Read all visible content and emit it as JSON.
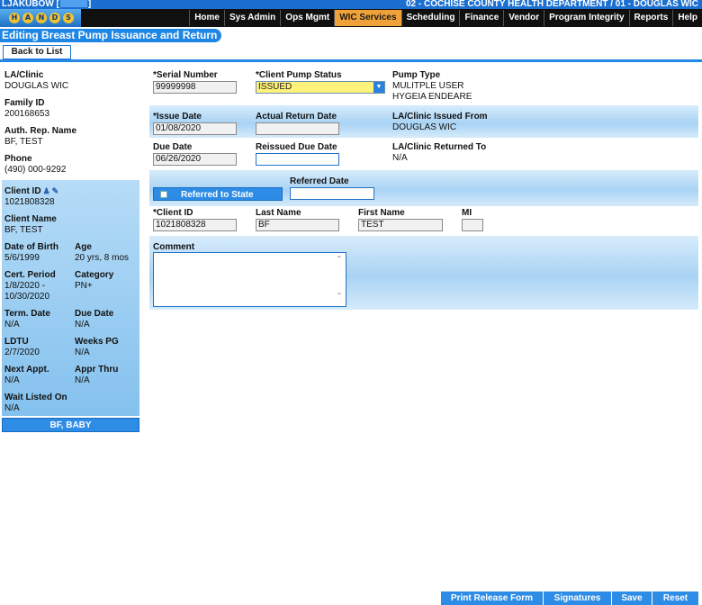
{
  "topbar": {
    "user": "LJAKUBOW [",
    "user_close": "]",
    "agency": "02 - COCHISE COUNTY HEALTH DEPARTMENT / 01 - DOUGLAS WIC"
  },
  "logo": {
    "letters": [
      "H",
      "A",
      "N",
      "D",
      "S"
    ]
  },
  "nav": {
    "items": [
      "Home",
      "Sys Admin",
      "Ops Mgmt",
      "WIC Services",
      "Scheduling",
      "Finance",
      "Vendor",
      "Program Integrity",
      "Reports",
      "Help"
    ],
    "active": "WIC Services"
  },
  "page": {
    "title": "Editing Breast Pump Issuance and Return",
    "back_label": "Back to List"
  },
  "sidebar": {
    "la_clinic_label": "LA/Clinic",
    "la_clinic": "DOUGLAS WIC",
    "family_id_label": "Family ID",
    "family_id": "200168653",
    "auth_rep_label": "Auth. Rep. Name",
    "auth_rep": "BF, TEST",
    "phone_label": "Phone",
    "phone": "(490) 000-9292",
    "client_id_label": "Client ID",
    "client_id": "1021808328",
    "client_name_label": "Client Name",
    "client_name": "BF, TEST",
    "dob_label": "Date of Birth",
    "dob": "5/6/1999",
    "age_label": "Age",
    "age": "20 yrs, 8 mos",
    "cert_label": "Cert. Period",
    "cert_start": "1/8/2020 -",
    "cert_end": "10/30/2020",
    "category_label": "Category",
    "category": "PN+",
    "term_label": "Term. Date",
    "term": "N/A",
    "due_label": "Due Date",
    "due": "N/A",
    "ldtu_label": "LDTU",
    "ldtu": "2/7/2020",
    "weeks_label": "Weeks PG",
    "weeks": "N/A",
    "next_appt_label": "Next Appt.",
    "next_appt": "N/A",
    "appr_label": "Appr Thru",
    "appr": "N/A",
    "wait_label": "Wait Listed On",
    "wait": "N/A",
    "baby_button": "BF, BABY"
  },
  "form": {
    "serial_label": "*Serial Number",
    "serial": "99999998",
    "status_label": "*Client Pump Status",
    "status": "ISSUED",
    "pump_type_label": "Pump Type",
    "pump_type_1": "MULITPLE USER",
    "pump_type_2": "HYGEIA ENDEARE",
    "issue_date_label": "*Issue Date",
    "issue_date": "01/08/2020",
    "return_date_label": "Actual Return Date",
    "return_date": "",
    "issued_from_label": "LA/Clinic Issued From",
    "issued_from": "DOUGLAS WIC",
    "due_date_label": "Due Date",
    "due_date": "06/26/2020",
    "reissued_label": "Reissued Due Date",
    "reissued": "",
    "returned_to_label": "LA/Clinic Returned To",
    "returned_to": "N/A",
    "referred_state_label": "Referred to State",
    "referred_date_label": "Referred Date",
    "referred_date": "",
    "client_id_label": "*Client ID",
    "client_id": "1021808328",
    "last_name_label": "Last Name",
    "last_name": "BF",
    "first_name_label": "First Name",
    "first_name": "TEST",
    "mi_label": "MI",
    "mi": "",
    "comment_label": "Comment",
    "comment": ""
  },
  "footer": {
    "print_label": "Print Release Form",
    "signatures_label": "Signatures",
    "save_label": "Save",
    "reset_label": "Reset"
  }
}
